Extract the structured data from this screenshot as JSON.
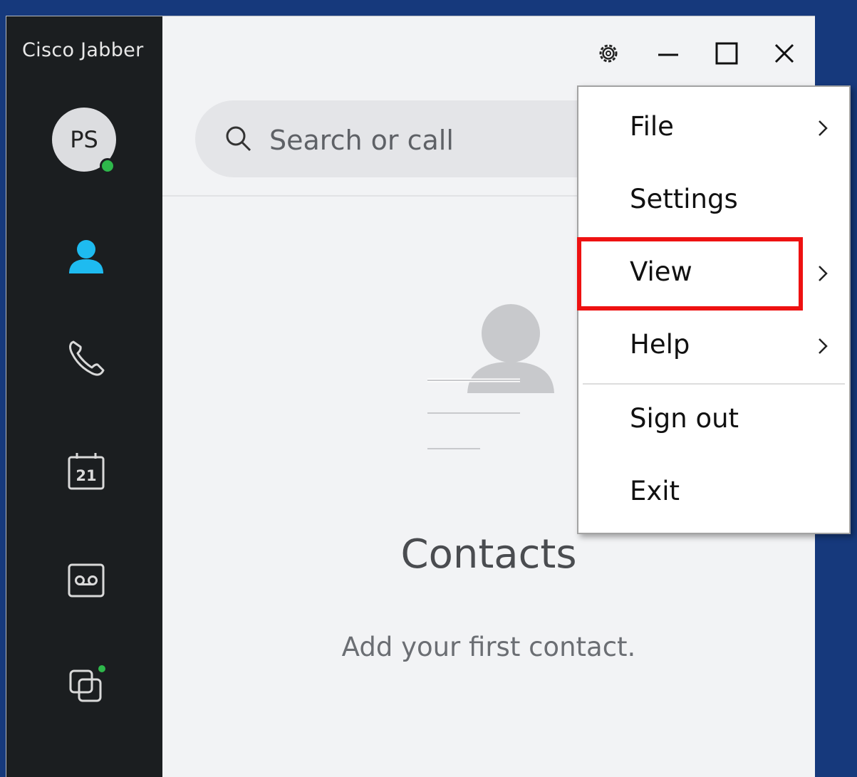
{
  "app": {
    "title": "Cisco Jabber",
    "avatar_initials": "PS"
  },
  "sidebar": {
    "items": [
      {
        "icon": "contacts-icon",
        "active": true
      },
      {
        "icon": "phone-icon"
      },
      {
        "icon": "calendar-icon",
        "label": "21"
      },
      {
        "icon": "voicemail-icon"
      },
      {
        "icon": "meetings-icon"
      }
    ]
  },
  "search": {
    "placeholder": "Search or call"
  },
  "empty_state": {
    "title": "Contacts",
    "subtitle": "Add your first contact."
  },
  "menu": {
    "items": [
      {
        "label": "File",
        "submenu": true
      },
      {
        "label": "Settings",
        "submenu": false
      },
      {
        "label": "View",
        "submenu": true,
        "highlighted": true
      },
      {
        "label": "Help",
        "submenu": true
      },
      {
        "label": "Sign out",
        "submenu": false
      },
      {
        "label": "Exit",
        "submenu": false
      }
    ]
  },
  "colors": {
    "desktop": "#16397c",
    "sidebar": "#1b1e20",
    "accent": "#1ebbf0",
    "presence": "#2eb84b",
    "highlight": "#ee1111"
  }
}
